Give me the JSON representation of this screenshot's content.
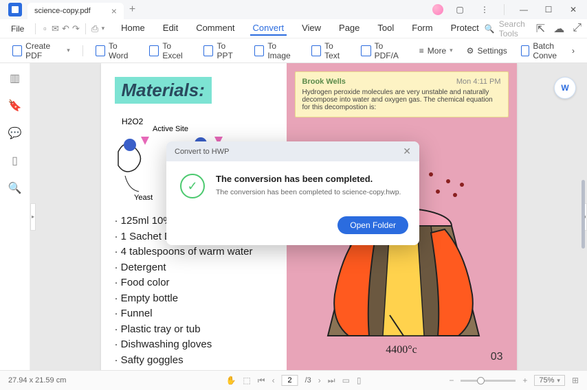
{
  "tab": {
    "title": "science-copy.pdf"
  },
  "menu": {
    "file": "File",
    "items": [
      "Home",
      "Edit",
      "Comment",
      "Convert",
      "View",
      "Page",
      "Tool",
      "Form",
      "Protect"
    ],
    "active_index": 3,
    "search_placeholder": "Search Tools"
  },
  "toolbar": {
    "create_pdf": "Create PDF",
    "to_word": "To Word",
    "to_excel": "To Excel",
    "to_ppt": "To PPT",
    "to_image": "To Image",
    "to_text": "To Text",
    "to_pdfa": "To PDF/A",
    "more": "More",
    "settings": "Settings",
    "batch": "Batch Conve"
  },
  "document": {
    "materials_heading": "Materials:",
    "diagram_labels": {
      "h2o2": "H2O2",
      "active_site": "Active Site",
      "yeast": "Yeast"
    },
    "list": [
      "125ml 10%",
      "1 Sachet D",
      "4 tablespoons of warm water",
      "Detergent",
      "Food color",
      "Empty bottle",
      "Funnel",
      "Plastic tray or tub",
      "Dishwashing gloves",
      "Safty goggles"
    ],
    "comment": {
      "author": "Brook Wells",
      "time": "Mon 4:11 PM",
      "text": "Hydrogen peroxide molecules are very unstable and naturally decompose into water and oxygen gas. The chemical equation for this decompostion is:"
    },
    "temperature": "4400°c",
    "page_number": "03"
  },
  "dialog": {
    "title": "Convert to HWP",
    "heading": "The conversion has been completed.",
    "text": "The conversion has been completed to science-copy.hwp.",
    "button": "Open Folder"
  },
  "status": {
    "dimensions": "27.94 x 21.59 cm",
    "current_page": "2",
    "total_pages": "/3",
    "zoom": "75%"
  }
}
